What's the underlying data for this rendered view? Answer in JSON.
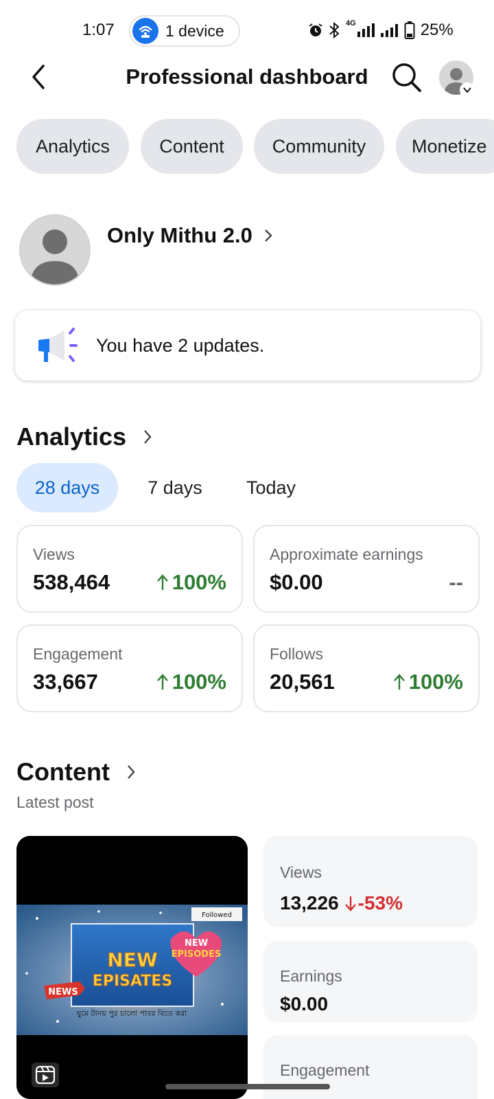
{
  "status_bar": {
    "time": "1:07",
    "hotspot_label": "1 device",
    "network": "4G",
    "battery": "25%"
  },
  "header": {
    "title": "Professional dashboard"
  },
  "tabs": [
    {
      "label": "Analytics"
    },
    {
      "label": "Content"
    },
    {
      "label": "Community"
    },
    {
      "label": "Monetize"
    }
  ],
  "profile": {
    "name": "Only Mithu 2.0"
  },
  "updates": {
    "text": "You have 2 updates."
  },
  "analytics": {
    "title": "Analytics",
    "ranges": [
      "28 days",
      "7 days",
      "Today"
    ],
    "selected_range": "28 days",
    "cards": [
      {
        "label": "Views",
        "value": "538,464",
        "change": "100%",
        "trend": "up"
      },
      {
        "label": "Approximate earnings",
        "value": "$0.00",
        "change": "--",
        "trend": "none"
      },
      {
        "label": "Engagement",
        "value": "33,667",
        "change": "100%",
        "trend": "up"
      },
      {
        "label": "Follows",
        "value": "20,561",
        "change": "100%",
        "trend": "up"
      }
    ]
  },
  "content": {
    "title": "Content",
    "subtitle": "Latest post",
    "thumbnail": {
      "headline_line1": "NEW",
      "headline_line2": "EPISATES",
      "badge": "NEWS",
      "ribbon_line1": "NEW",
      "ribbon_line2": "EPISODES",
      "followed_tag": "Followed",
      "caption": "ঘুমে টানয় পুর চালো পাবর বিতে করা"
    },
    "metrics": [
      {
        "label": "Views",
        "value": "13,226",
        "change": "-53%",
        "trend": "down"
      },
      {
        "label": "Earnings",
        "value": "$0.00"
      },
      {
        "label": "Engagement",
        "value": ""
      }
    ]
  },
  "colors": {
    "accent": "#0a63c9",
    "chip_bg": "#e4e6eb",
    "positive": "#2e7d32",
    "negative": "#d32f2f",
    "hotspot": "#1a73e8"
  }
}
